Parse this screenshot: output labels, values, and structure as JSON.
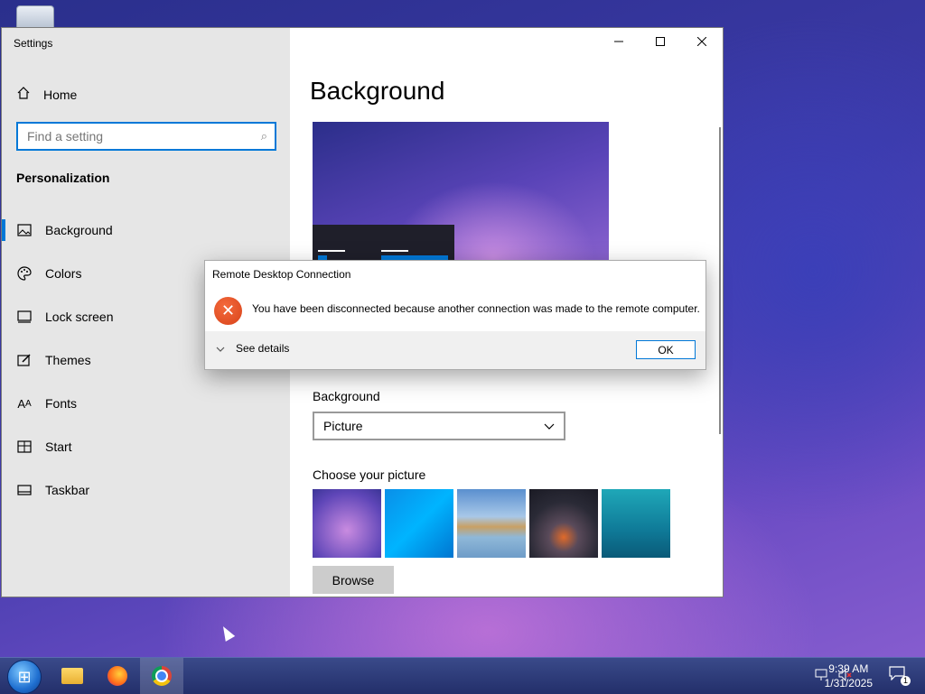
{
  "settings": {
    "window_title": "Settings",
    "home_label": "Home",
    "search_placeholder": "Find a setting",
    "section_title": "Personalization",
    "nav": [
      {
        "label": "Background",
        "icon": "picture-icon"
      },
      {
        "label": "Colors",
        "icon": "palette-icon"
      },
      {
        "label": "Lock screen",
        "icon": "lock-screen-icon"
      },
      {
        "label": "Themes",
        "icon": "themes-icon"
      },
      {
        "label": "Fonts",
        "icon": "fonts-icon"
      },
      {
        "label": "Start",
        "icon": "start-icon"
      },
      {
        "label": "Taskbar",
        "icon": "taskbar-icon"
      }
    ],
    "page_title": "Background",
    "background_label": "Background",
    "background_value": "Picture",
    "choose_label": "Choose your picture",
    "browse_label": "Browse",
    "accent_color": "#0078d7"
  },
  "dialog": {
    "title": "Remote Desktop Connection",
    "message": "You have been disconnected because another connection was made to the remote computer.",
    "details_label": "See details",
    "ok_label": "OK"
  },
  "taskbar": {
    "time": "9:39 AM",
    "date": "1/31/2025",
    "notification_count": "1"
  }
}
